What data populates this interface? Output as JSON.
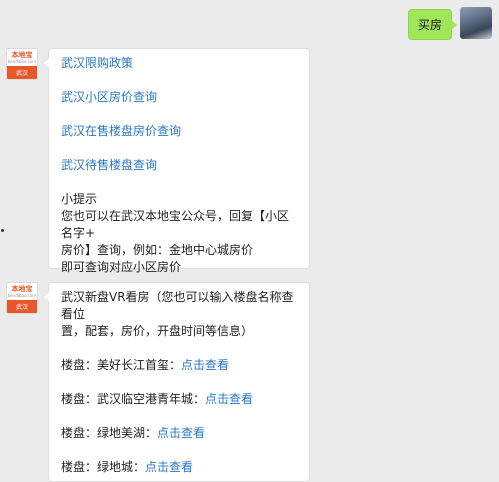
{
  "outgoing": {
    "text": "买房"
  },
  "brand": {
    "name": "本地宝",
    "sub": "bendibao.com",
    "city": "武汉"
  },
  "msg1": {
    "links": [
      "武汉限购政策",
      "武汉小区房价查询",
      "武汉在售楼盘房价查询",
      "武汉待售楼盘查询"
    ],
    "tip_title": "小提示",
    "tip_lines": [
      "您也可以在武汉本地宝公众号，回复【小区名字+",
      "房价】查询，例如：金地中心城房价",
      "即可查询对应小区房价"
    ]
  },
  "msg2": {
    "intro_lines": [
      "武汉新盘VR看房（您也可以输入楼盘名称查看位",
      "置，配套，房价，开盘时间等信息）"
    ],
    "items": [
      {
        "label": "楼盘：美好长江首玺：",
        "link": "点击查看"
      },
      {
        "label": "楼盘：武汉临空港青年城：",
        "link": "点击查看"
      },
      {
        "label": "楼盘：绿地美湖：",
        "link": "点击查看"
      },
      {
        "label": "楼盘：绿地城：",
        "link": "点击查看"
      }
    ]
  }
}
